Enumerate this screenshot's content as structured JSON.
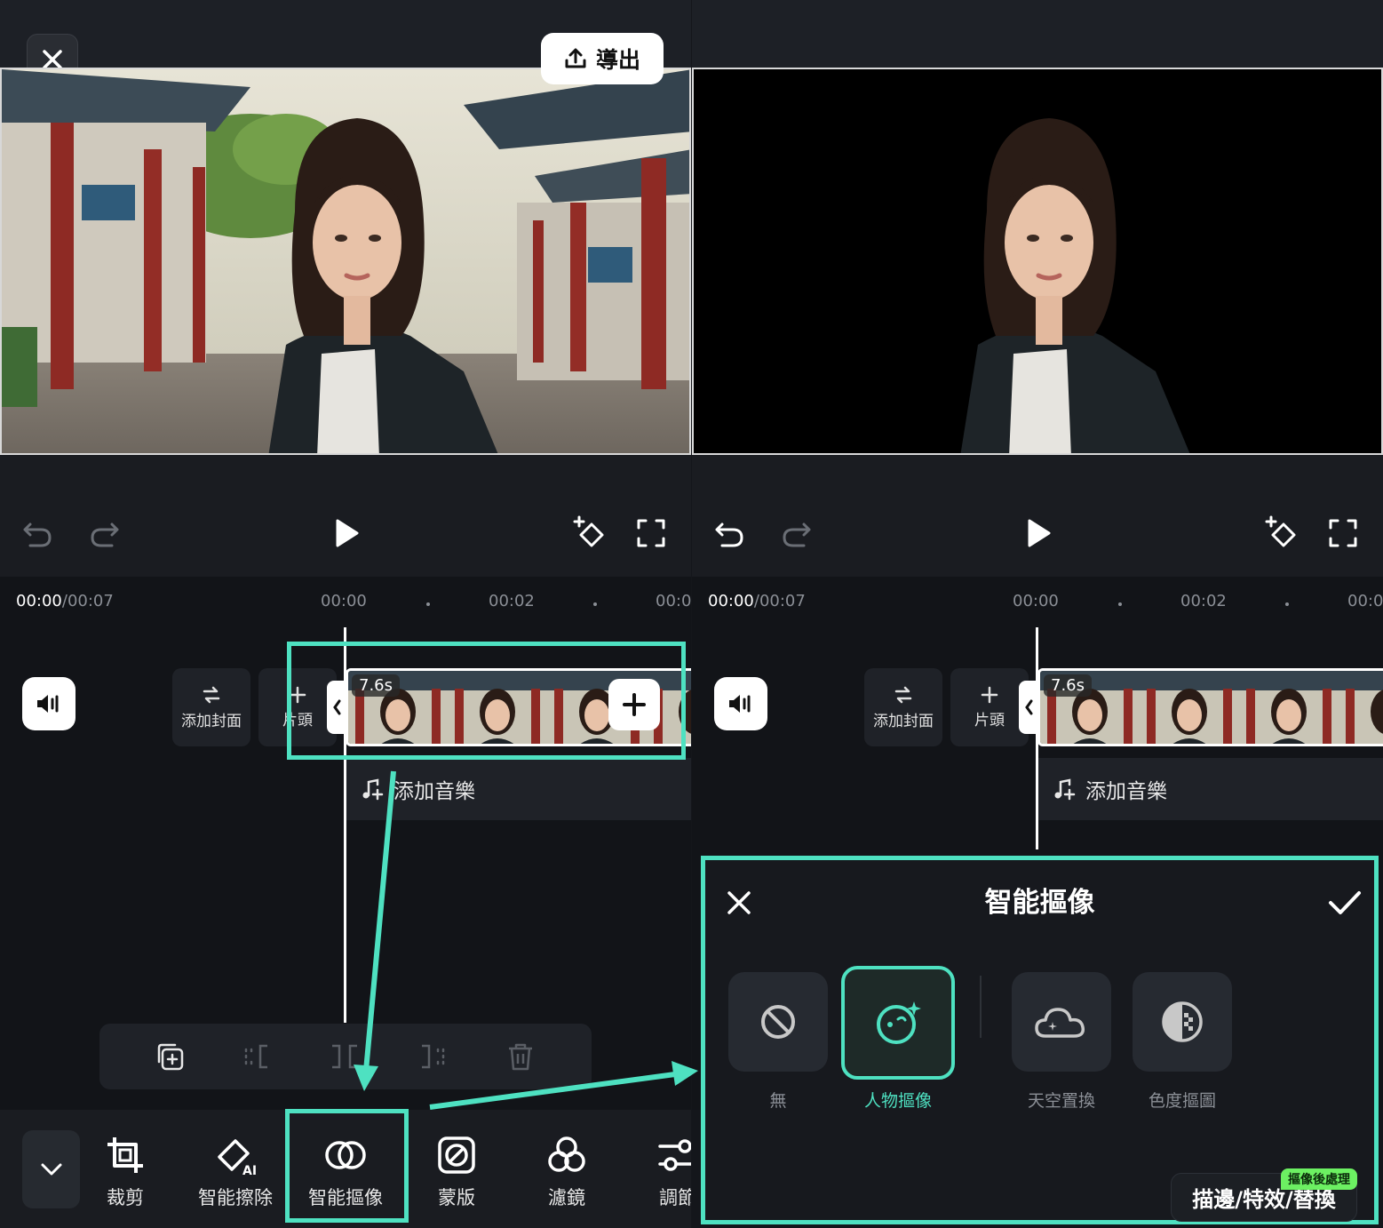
{
  "export_label": "導出",
  "left": {
    "time_current": "00:00",
    "time_total": "/00:07",
    "ticks": [
      "00:00",
      "00:02",
      "00:0"
    ],
    "add_cover": "添加封面",
    "intro": "片頭",
    "clip_duration": "7.6s",
    "add_music": "添加音樂",
    "tools": [
      "裁剪",
      "智能擦除",
      "智能摳像",
      "蒙版",
      "濾鏡",
      "調節"
    ]
  },
  "right": {
    "time_current": "00:00",
    "time_total": "/00:07",
    "ticks": [
      "00:00",
      "00:02",
      "00:0"
    ],
    "add_cover": "添加封面",
    "intro": "片頭",
    "clip_duration": "7.6s",
    "add_music": "添加音樂"
  },
  "panel": {
    "title": "智能摳像",
    "options": [
      "無",
      "人物摳像",
      "天空置換",
      "色度摳圖"
    ],
    "selected": "人物摳像",
    "extra_button": "描邊/特效/替換",
    "extra_badge": "摳像後處理"
  },
  "colors": {
    "accent": "#4ee1c1",
    "badge": "#6cf062"
  }
}
